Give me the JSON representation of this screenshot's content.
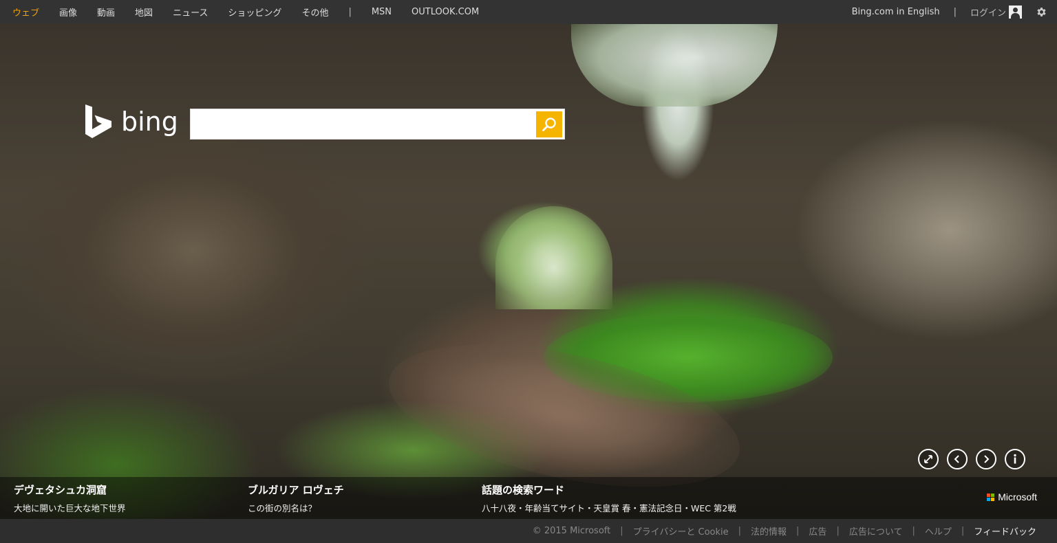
{
  "topnav": {
    "items": [
      {
        "label": "ウェブ",
        "active": true
      },
      {
        "label": "画像"
      },
      {
        "label": "動画"
      },
      {
        "label": "地図"
      },
      {
        "label": "ニュース"
      },
      {
        "label": "ショッピング"
      },
      {
        "label": "その他"
      }
    ],
    "separator": "|",
    "links": [
      "MSN",
      "OUTLOOK.COM"
    ],
    "english_link": "Bing.com in English",
    "login": "ログイン"
  },
  "brand": {
    "logo_text": "bing"
  },
  "search": {
    "value": "",
    "placeholder": ""
  },
  "info": [
    {
      "title": "デヴェタシュカ洞窟",
      "sub": "大地に開いた巨大な地下世界"
    },
    {
      "title": "ブルガリア ロヴェチ",
      "sub": "この街の別名は？"
    },
    {
      "title": "話題の検索ワード",
      "sub": "八十八夜・年齢当てサイト・天皇賞 春・憲法記念日・WEC 第2戦"
    }
  ],
  "microsoft_label": "Microsoft",
  "footer": {
    "items": [
      "© 2015 Microsoft",
      "プライバシーと Cookie",
      "法的情報",
      "広告",
      "広告について",
      "ヘルプ",
      "フィードバック"
    ]
  },
  "colors": {
    "accent": "#f0a30a",
    "search_button": "#f4b400",
    "topbar": "#333333"
  }
}
